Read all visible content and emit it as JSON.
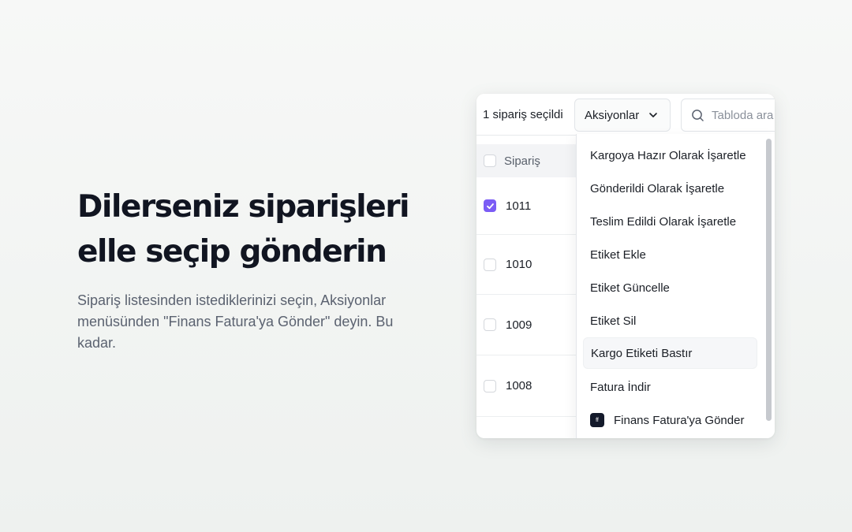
{
  "hero": {
    "title_line1": "Dilerseniz siparişleri",
    "title_line2": "elle seçip gönderin",
    "description": "Sipariş listesinden istediklerinizi seçin, Aksiyonlar menüsünden \"Finans Fatura'ya Gönder\" deyin. Bu kadar."
  },
  "toolbar": {
    "selection_count": "1 sipariş seçildi",
    "actions_label": "Aksiyonlar",
    "search_placeholder": "Tabloda ara"
  },
  "table": {
    "column_header": "Sipariş",
    "rows": [
      {
        "id": "1011",
        "checked": true
      },
      {
        "id": "1010",
        "checked": false
      },
      {
        "id": "1009",
        "checked": false
      },
      {
        "id": "1008",
        "checked": false
      }
    ]
  },
  "menu": {
    "items": [
      "Kargoya Hazır Olarak İşaretle",
      "Gönderildi Olarak İşaretle",
      "Teslim Edildi Olarak İşaretle",
      "Etiket Ekle",
      "Etiket Güncelle",
      "Etiket Sil",
      "Kargo Etiketi Bastır",
      "Fatura İndir",
      "Finans Fatura'ya Gönder"
    ],
    "highlighted_item": "Kargo Etiketi Bastır",
    "logo_text": "ff"
  },
  "colors": {
    "accent": "#7b5cf5",
    "logo_bg": "#141a2b"
  }
}
